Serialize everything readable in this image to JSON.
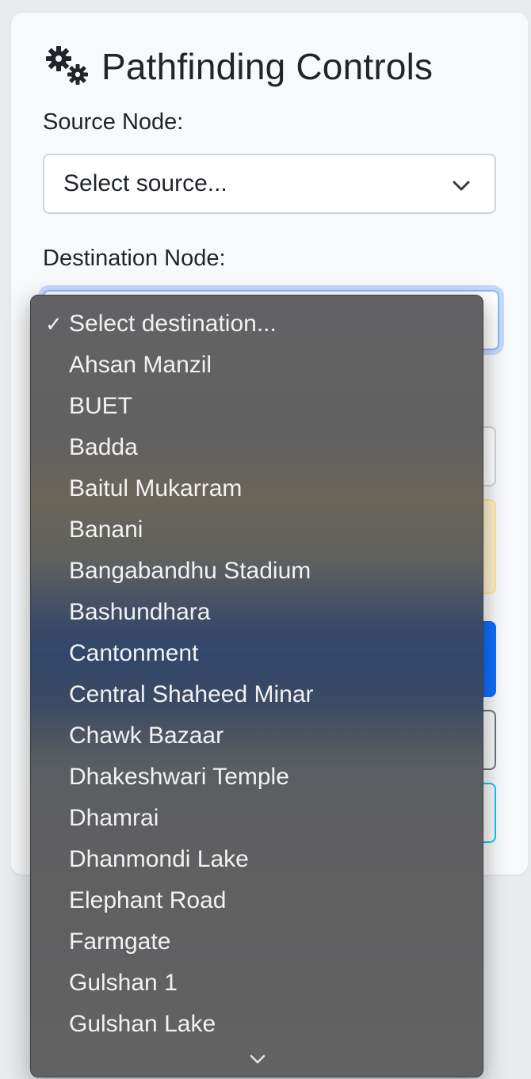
{
  "panel": {
    "title": "Pathfinding Controls",
    "title_icon": "gears-icon"
  },
  "source": {
    "label": "Source Node:",
    "selected": "Select source..."
  },
  "destination": {
    "label": "Destination Node:",
    "selected": "Select destination..."
  },
  "dropdown": {
    "options": [
      "Select destination...",
      "Ahsan Manzil",
      "BUET",
      "Badda",
      "Baitul Mukarram",
      "Banani",
      "Bangabandhu Stadium",
      "Bashundhara",
      "Cantonment",
      "Central Shaheed Minar",
      "Chawk Bazaar",
      "Dhakeshwari Temple",
      "Dhamrai",
      "Dhanmondi Lake",
      "Elephant Road",
      "Farmgate",
      "Gulshan 1",
      "Gulshan Lake"
    ],
    "checked_index": 0,
    "more_icon": "chevron-down-icon"
  },
  "colors": {
    "primary": "#0d6efd",
    "warning_bg": "#fff3cd",
    "info_border": "#0dcaf0"
  }
}
